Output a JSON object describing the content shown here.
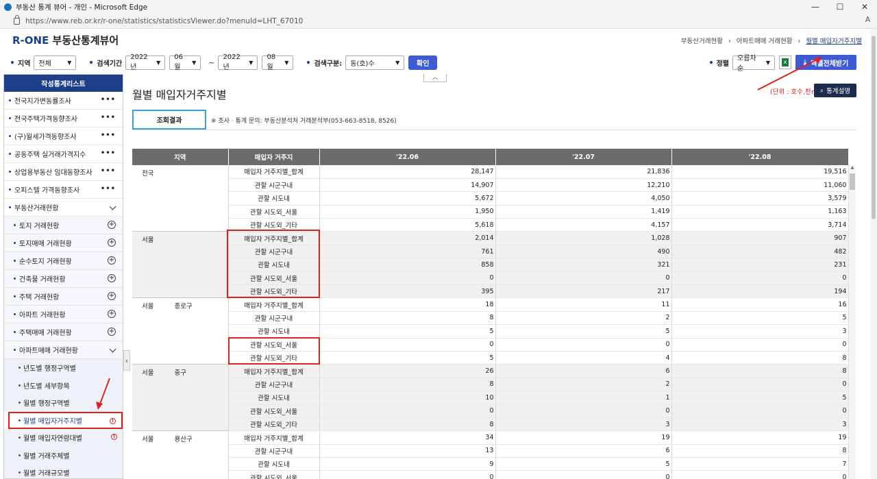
{
  "window": {
    "title": "부동산 통계 뷰어 - 개인 - Microsoft Edge",
    "min": "—",
    "max": "☐",
    "close": "✕"
  },
  "address": {
    "url": "https://www.reb.or.kr/r-one/statistics/statisticsViewer.do?menuId=LHT_67010",
    "read_icon": "A"
  },
  "header": {
    "logo_brand": "R-ONE",
    "logo_text": " 부동산통계뷰어"
  },
  "breadcrumb": [
    "부동산거래현황",
    "아파트매매 거래현황",
    "월별 매입자거주지별"
  ],
  "breadcrumb_sep": "›",
  "filters": {
    "region_label": "지역",
    "region_value": "전체",
    "period_label": "검색기간",
    "start_year": "2022년",
    "start_month": "06월",
    "dash": "~",
    "end_year": "2022년",
    "end_month": "08월",
    "type_label": "검색구분:",
    "type_value": "동(호)수",
    "confirm": "확인",
    "sort_label": "정렬",
    "sort_value": "오름차순",
    "excel": "엑셀전체받기",
    "caret": "▼"
  },
  "sidebar": {
    "title": "작성통계리스트",
    "top_items": [
      "전국지가변동률조사",
      "전국주택가격동향조사",
      "(구)월세가격동향조사",
      "공동주택 실거래가격지수",
      "상업용부동산 임대동향조사",
      "오피스텔 가격동향조사"
    ],
    "more": "•••",
    "section": "부동산거래현황",
    "sub_items": [
      "토지 거래현황",
      "토지매매 거래현황",
      "순수토지 거래현황",
      "건축물 거래현황",
      "주택 거래현황",
      "아파트 거래현황",
      "주택매매 거래현황"
    ],
    "plus": "+",
    "open_sub": "아파트매매 거래현황",
    "leaves": [
      "년도별 행정구역별",
      "년도별 세부항목",
      "월별 행정구역별",
      "월별 매입자거주지별",
      "월별 매입자연령대별",
      "월별 거래주체별",
      "월별 거래규모별"
    ],
    "info": "!",
    "collapse": "‹"
  },
  "content": {
    "title": "월별 매입자거주지별",
    "unit": "(단위 : 호수,천㎡)",
    "stat_button": "통계설명",
    "tab": "조회결과",
    "note": "※ 조사 · 통계 문의: 부동산분석처 거래분석부(053-663-8518, 8526)",
    "up": "︿"
  },
  "table": {
    "headers": [
      "지역",
      "매입자 거주지",
      "'22.06",
      "'22.07",
      "'22.08"
    ],
    "groups": [
      {
        "region": "전국",
        "sub": "",
        "rows": [
          [
            "매입자 거주지별_합계",
            "28,147",
            "21,836",
            "19,516"
          ],
          [
            "관할 시군구내",
            "14,907",
            "12,210",
            "11,060"
          ],
          [
            "관할 시도내",
            "5,672",
            "4,050",
            "3,579"
          ],
          [
            "관할 시도외_서울",
            "1,950",
            "1,419",
            "1,163"
          ],
          [
            "관할 시도외_기타",
            "5,618",
            "4,157",
            "3,714"
          ]
        ]
      },
      {
        "region": "서울",
        "sub": "",
        "rows": [
          [
            "매입자 거주지별_합계",
            "2,014",
            "1,028",
            "907"
          ],
          [
            "관할 시군구내",
            "761",
            "490",
            "482"
          ],
          [
            "관할 시도내",
            "858",
            "321",
            "231"
          ],
          [
            "관할 시도외_서울",
            "0",
            "0",
            "0"
          ],
          [
            "관할 시도외_기타",
            "395",
            "217",
            "194"
          ]
        ]
      },
      {
        "region": "서울",
        "sub": "종로구",
        "rows": [
          [
            "매입자 거주지별_합계",
            "18",
            "11",
            "16"
          ],
          [
            "관할 시군구내",
            "8",
            "2",
            "5"
          ],
          [
            "관할 시도내",
            "5",
            "5",
            "3"
          ],
          [
            "관할 시도외_서울",
            "0",
            "0",
            "0"
          ],
          [
            "관할 시도외_기타",
            "5",
            "4",
            "8"
          ]
        ]
      },
      {
        "region": "서울",
        "sub": "중구",
        "rows": [
          [
            "매입자 거주지별_합계",
            "26",
            "6",
            "8"
          ],
          [
            "관할 시군구내",
            "8",
            "2",
            "0"
          ],
          [
            "관할 시도내",
            "10",
            "1",
            "5"
          ],
          [
            "관할 시도외_서울",
            "0",
            "0",
            "0"
          ],
          [
            "관할 시도외_기타",
            "8",
            "3",
            "3"
          ]
        ]
      },
      {
        "region": "서울",
        "sub": "용산구",
        "rows": [
          [
            "매입자 거주지별_합계",
            "34",
            "19",
            "19"
          ],
          [
            "관할 시군구내",
            "13",
            "6",
            "8"
          ],
          [
            "관할 시도내",
            "9",
            "5",
            "7"
          ],
          [
            "관할 시도외_서울",
            "0",
            "0",
            "0"
          ]
        ]
      }
    ]
  }
}
